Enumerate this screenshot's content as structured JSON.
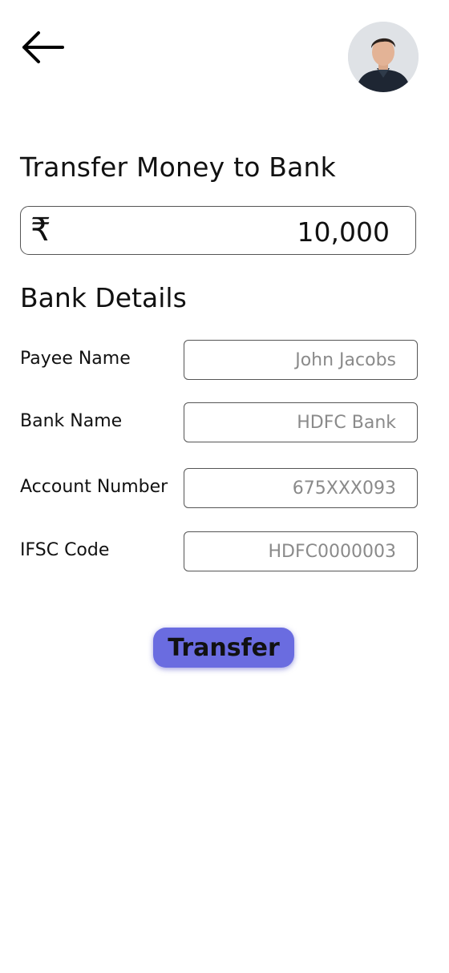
{
  "header": {
    "back_icon": "arrow-left-icon",
    "avatar_alt": "user-avatar"
  },
  "transfer": {
    "title": "Transfer Money to Bank",
    "currency_symbol": "₹",
    "amount": "10,000"
  },
  "bank_details": {
    "title": "Bank Details",
    "fields": [
      {
        "label": "Payee Name",
        "placeholder": "John Jacobs"
      },
      {
        "label": "Bank Name",
        "placeholder": "HDFC Bank"
      },
      {
        "label": "Account Number",
        "placeholder": "675XXX093"
      },
      {
        "label": "IFSC Code",
        "placeholder": "HDFC0000003"
      }
    ]
  },
  "actions": {
    "transfer_label": "Transfer"
  },
  "colors": {
    "accent": "#6a6ce0",
    "border": "#555555",
    "placeholder": "#8a8a8a"
  }
}
